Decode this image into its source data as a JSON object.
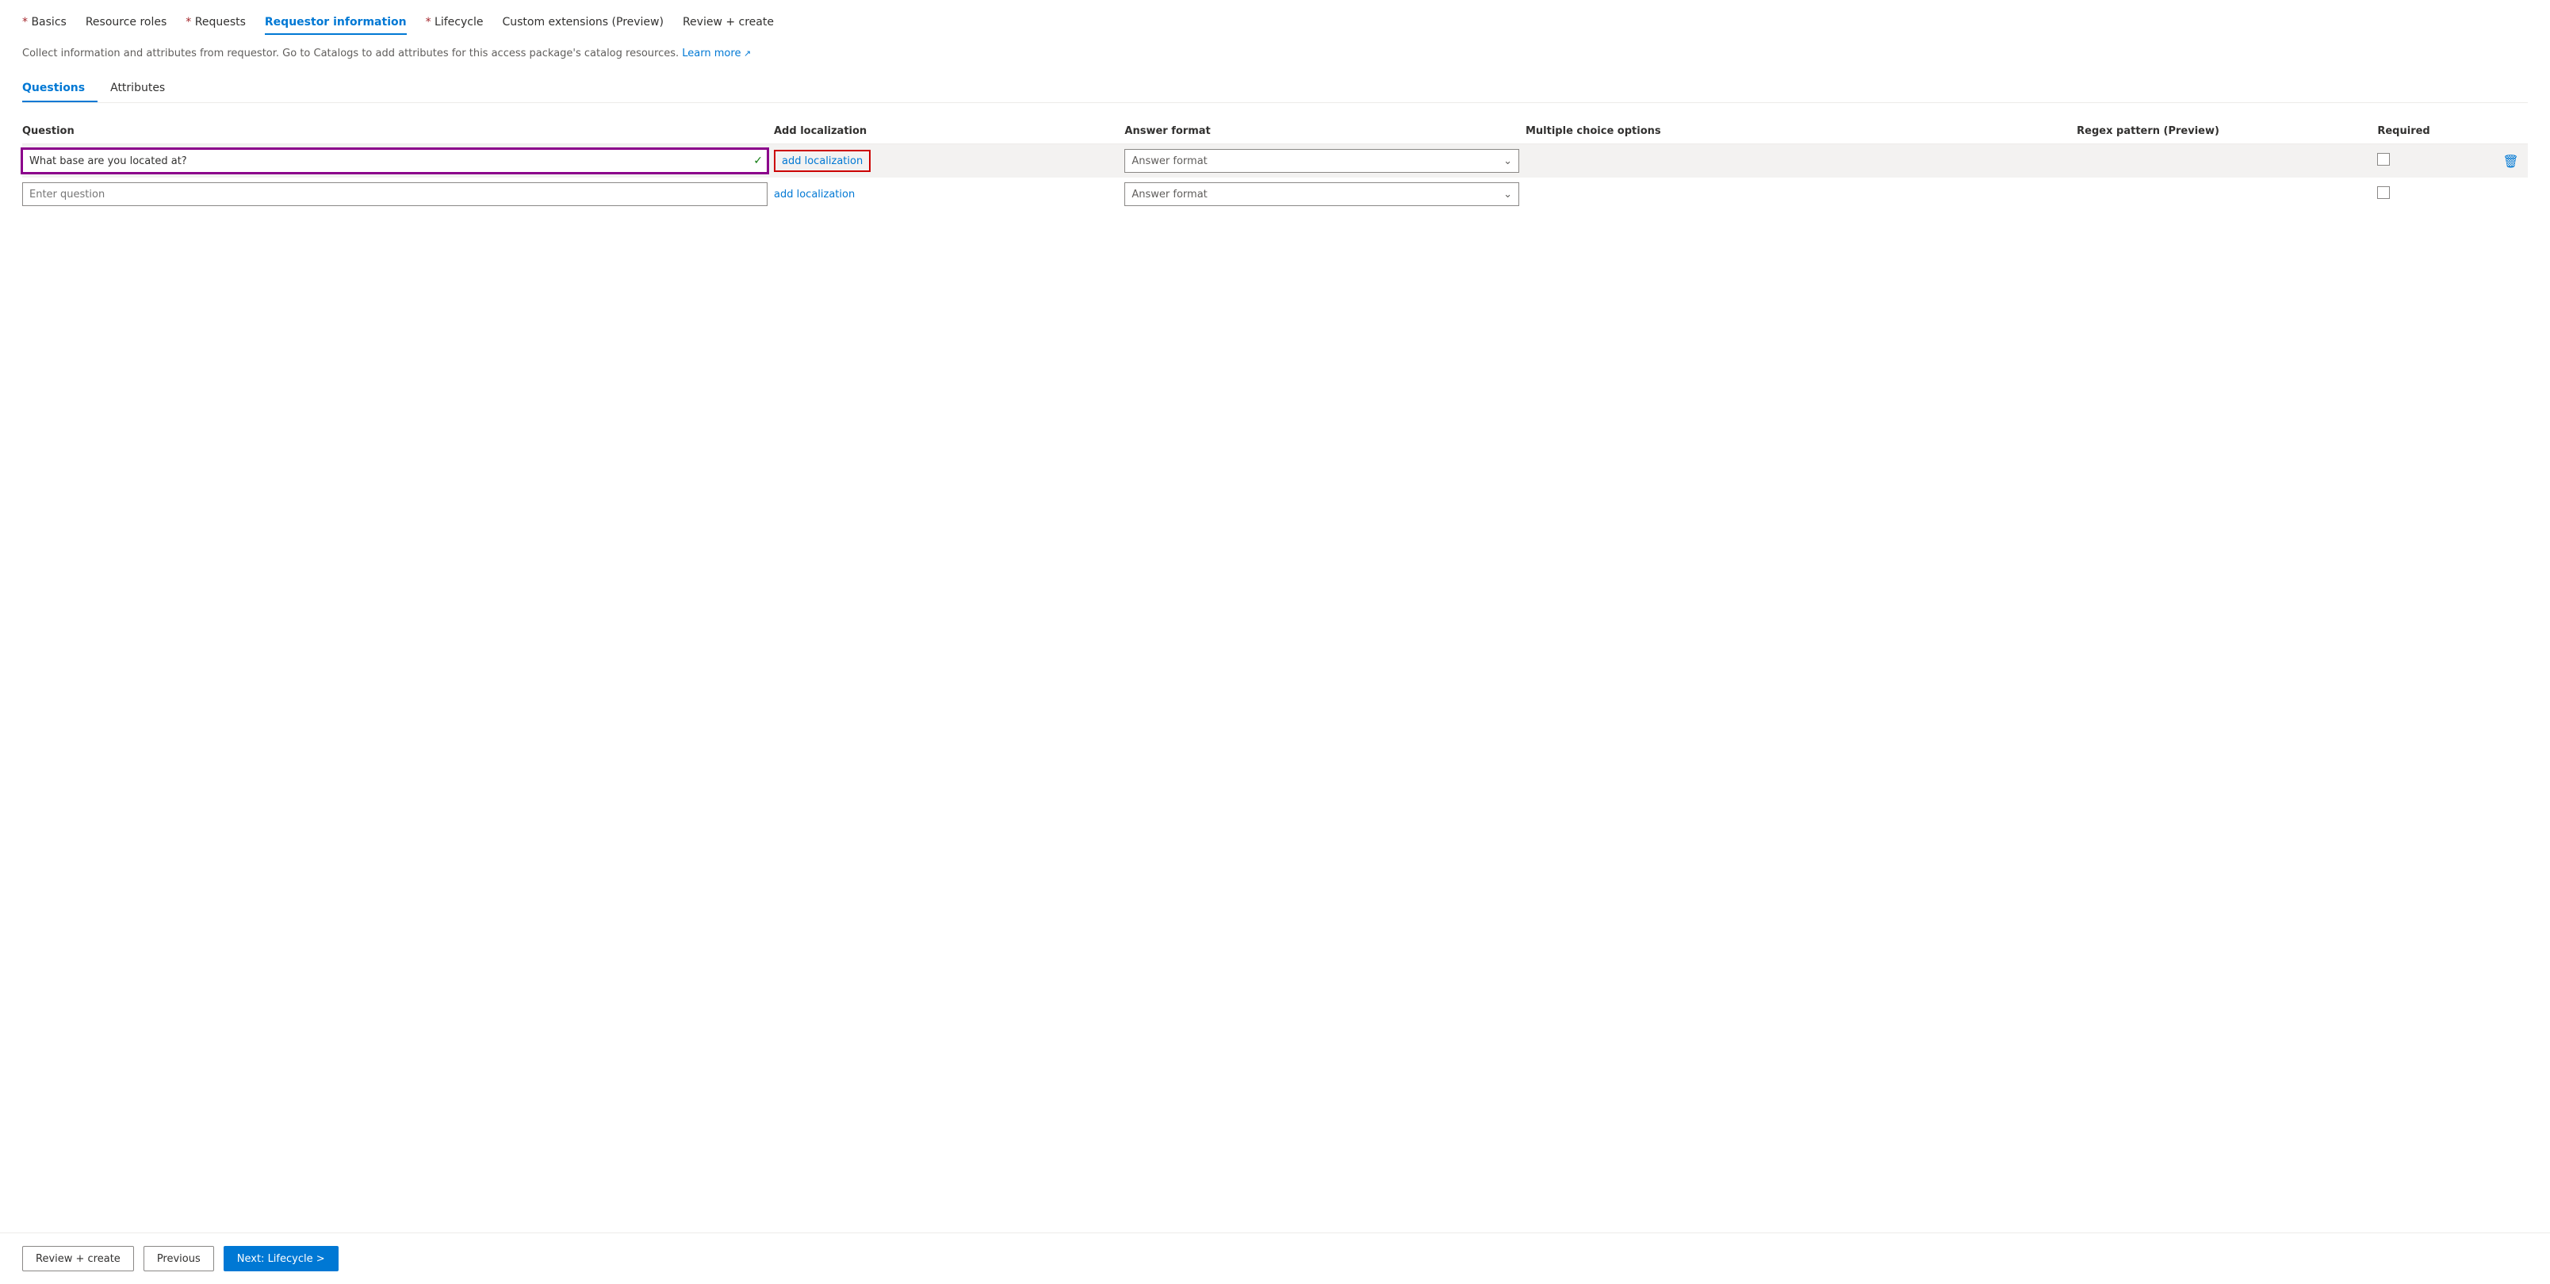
{
  "nav": {
    "tabs": [
      {
        "id": "basics",
        "label": "Basics",
        "required": true,
        "active": false
      },
      {
        "id": "resource-roles",
        "label": "Resource roles",
        "required": false,
        "active": false
      },
      {
        "id": "requests",
        "label": "Requests",
        "required": true,
        "active": false
      },
      {
        "id": "requestor-information",
        "label": "Requestor information",
        "required": false,
        "active": true
      },
      {
        "id": "lifecycle",
        "label": "Lifecycle",
        "required": true,
        "active": false
      },
      {
        "id": "custom-extensions",
        "label": "Custom extensions (Preview)",
        "required": false,
        "active": false
      },
      {
        "id": "review-create",
        "label": "Review + create",
        "required": false,
        "active": false
      }
    ]
  },
  "description": {
    "text": "Collect information and attributes from requestor. Go to Catalogs to add attributes for this access package's catalog resources.",
    "link_text": "Learn more",
    "link_icon": "↗"
  },
  "sub_tabs": [
    {
      "id": "questions",
      "label": "Questions",
      "active": true
    },
    {
      "id": "attributes",
      "label": "Attributes",
      "active": false
    }
  ],
  "table": {
    "columns": [
      {
        "id": "question",
        "label": "Question"
      },
      {
        "id": "localization",
        "label": "Add localization"
      },
      {
        "id": "answer",
        "label": "Answer format"
      },
      {
        "id": "multiple",
        "label": "Multiple choice options"
      },
      {
        "id": "regex",
        "label": "Regex pattern (Preview)"
      },
      {
        "id": "required",
        "label": "Required"
      }
    ],
    "rows": [
      {
        "id": "row1",
        "question_value": "What base are you located at?",
        "question_placeholder": "",
        "has_check": true,
        "localization_label": "add localization",
        "localization_highlighted": true,
        "answer_format": "Answer format",
        "required_checked": false,
        "has_delete": true,
        "highlighted": true
      },
      {
        "id": "row2",
        "question_value": "",
        "question_placeholder": "Enter question",
        "has_check": false,
        "localization_label": "add localization",
        "localization_highlighted": false,
        "answer_format": "Answer format",
        "required_checked": false,
        "has_delete": false,
        "highlighted": false
      }
    ]
  },
  "footer": {
    "review_create_label": "Review + create",
    "previous_label": "Previous",
    "next_label": "Next: Lifecycle >"
  }
}
